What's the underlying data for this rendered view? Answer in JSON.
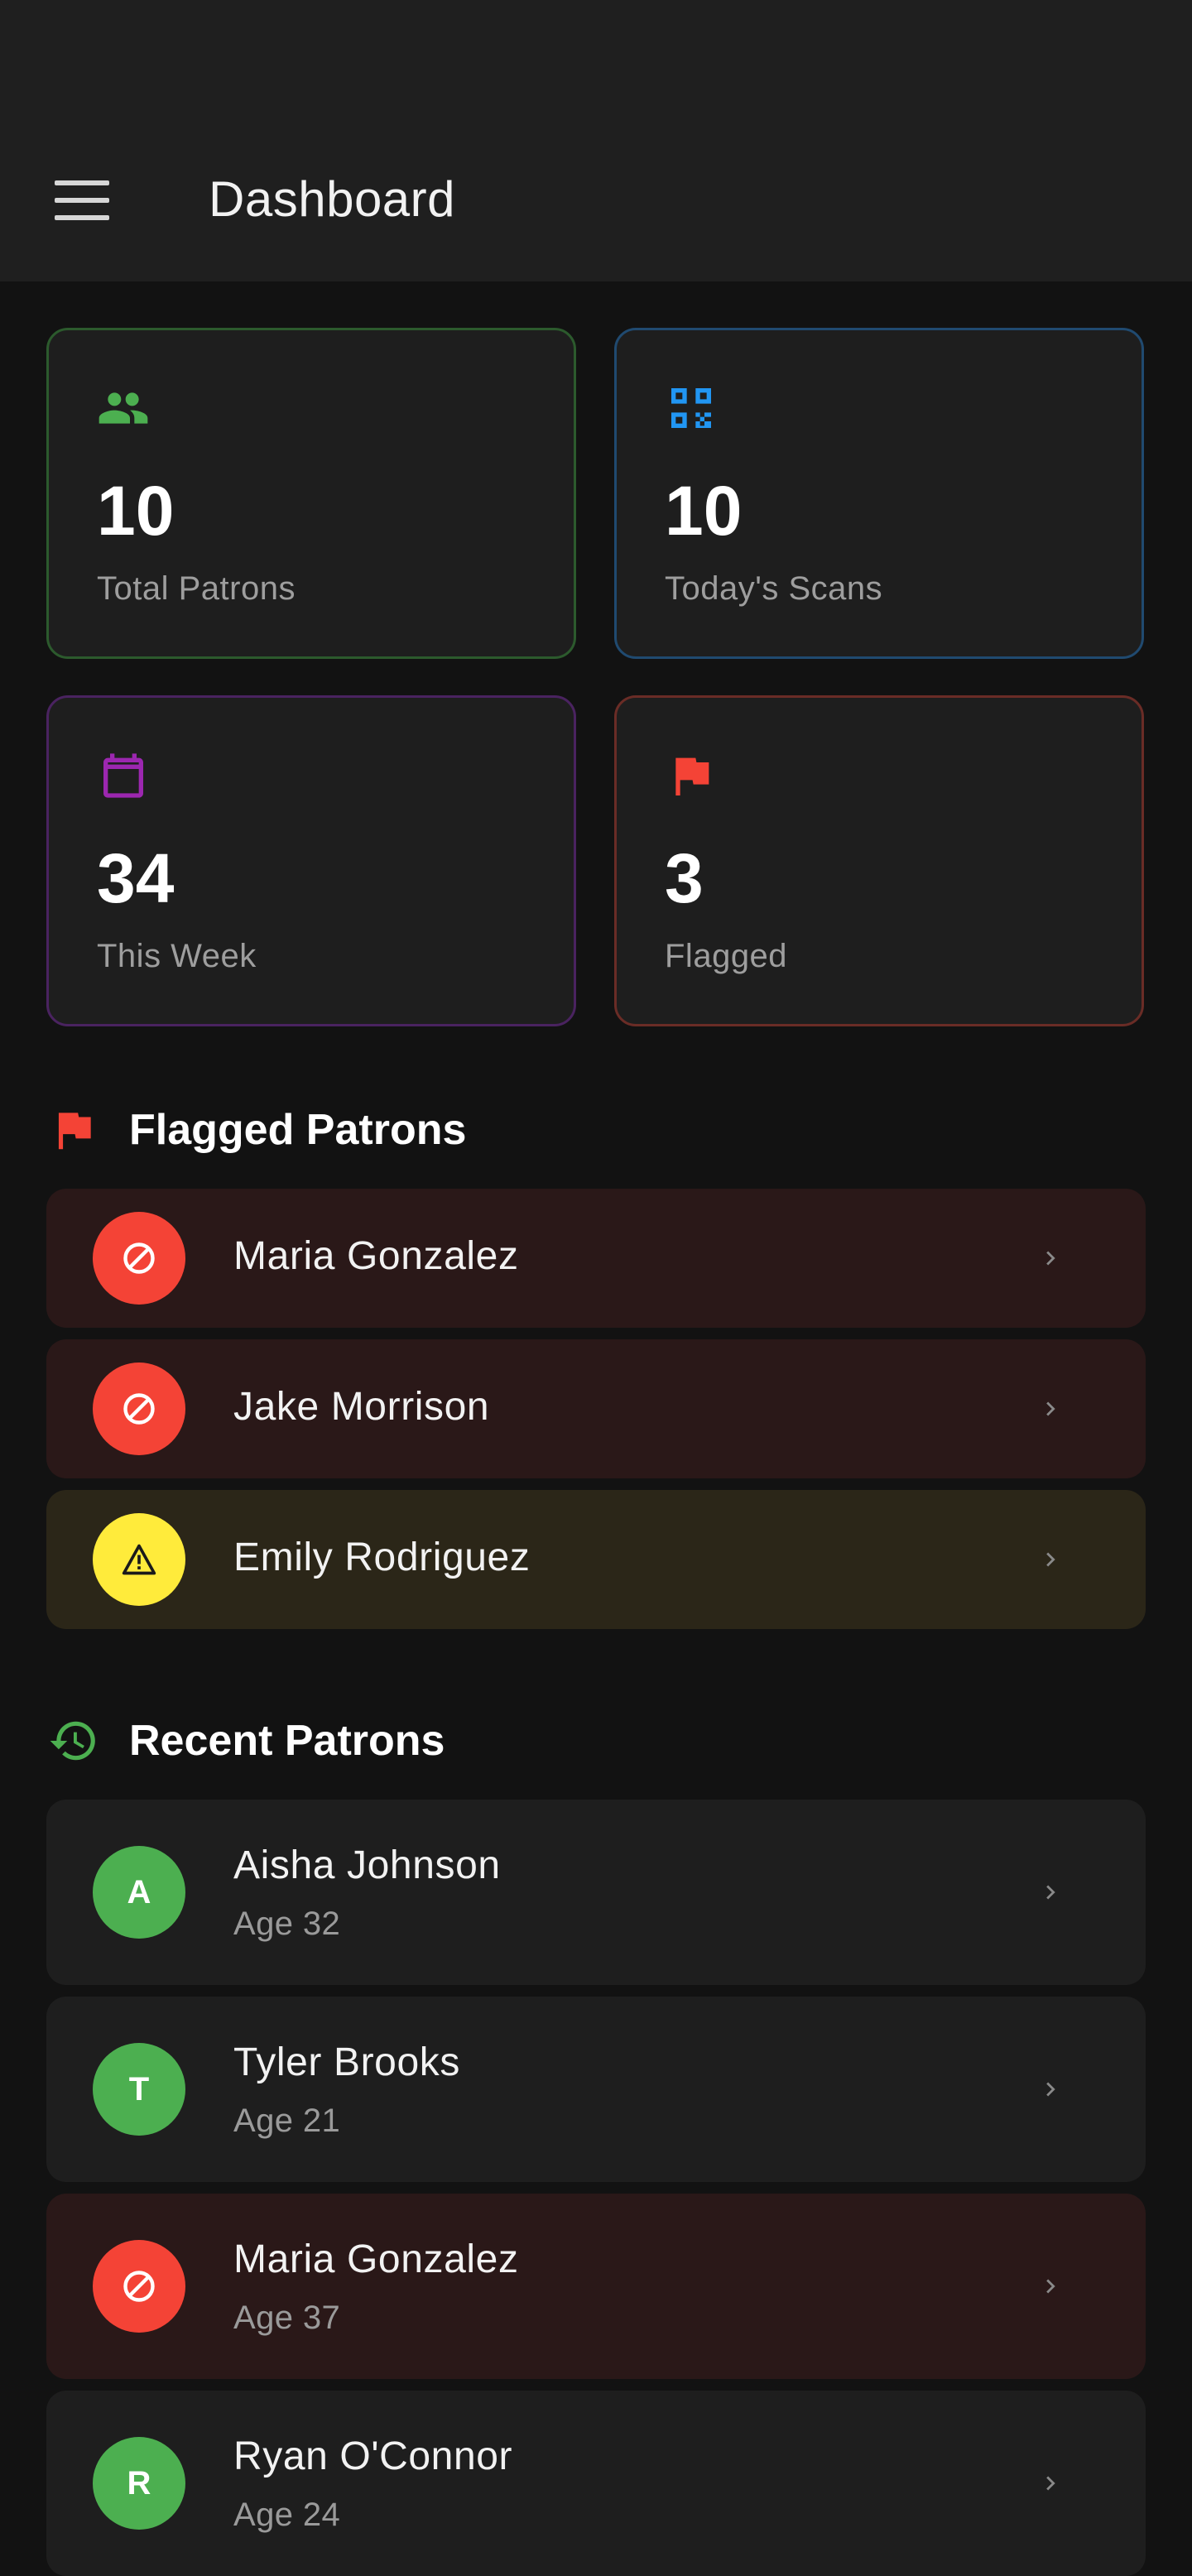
{
  "appbar": {
    "title": "Dashboard",
    "menu_icon": "menu-icon"
  },
  "stats": [
    {
      "value": "10",
      "label": "Total Patrons",
      "icon": "people-icon",
      "color": "#4caf50"
    },
    {
      "value": "10",
      "label": "Today's Scans",
      "icon": "qr-code-scanner-icon",
      "color": "#2196f3"
    },
    {
      "value": "34",
      "label": "This Week",
      "icon": "calendar-icon",
      "color": "#9c27b0"
    },
    {
      "value": "3",
      "label": "Flagged",
      "icon": "flag-icon",
      "color": "#f44336"
    }
  ],
  "flagged_section": {
    "title": "Flagged Patrons",
    "icon": "flag-icon",
    "items": [
      {
        "name": "Maria Gonzalez",
        "status": "banned",
        "icon": "block-icon"
      },
      {
        "name": "Jake Morrison",
        "status": "banned",
        "icon": "block-icon"
      },
      {
        "name": "Emily Rodriguez",
        "status": "warning",
        "icon": "warning-icon"
      }
    ]
  },
  "recent_section": {
    "title": "Recent Patrons",
    "icon": "history-icon",
    "items": [
      {
        "name": "Aisha Johnson",
        "age": "Age 32",
        "initial": "A",
        "status": "normal"
      },
      {
        "name": "Tyler Brooks",
        "age": "Age 21",
        "initial": "T",
        "status": "normal"
      },
      {
        "name": "Maria Gonzalez",
        "age": "Age 37",
        "initial": "",
        "status": "banned"
      },
      {
        "name": "Ryan O'Connor",
        "age": "Age 24",
        "initial": "R",
        "status": "normal"
      }
    ]
  },
  "colors": {
    "background": "#121212",
    "appbar": "#1f1f1f",
    "card": "#1e1e1e",
    "banned": "#f44336",
    "warning": "#ffeb3b",
    "normal": "#4caf50"
  }
}
